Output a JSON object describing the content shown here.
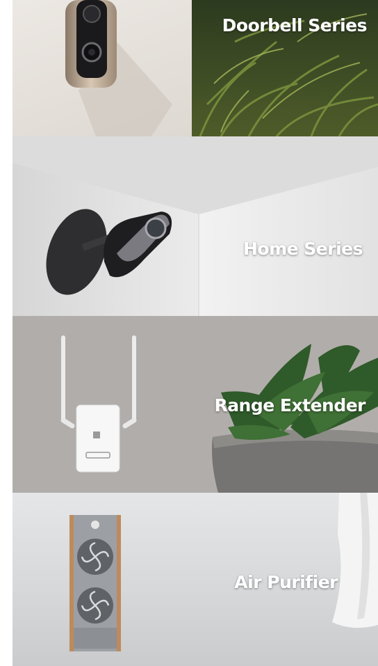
{
  "categories": [
    {
      "label": "Doorbell Series",
      "image": "doorbell-camera-with-plants"
    },
    {
      "label": "Home Series",
      "image": "wall-mounted-home-camera"
    },
    {
      "label": "Range Extender",
      "image": "wifi-range-extender-with-succulent"
    },
    {
      "label": "Air Purifier",
      "image": "air-purifier-with-curtain"
    }
  ]
}
